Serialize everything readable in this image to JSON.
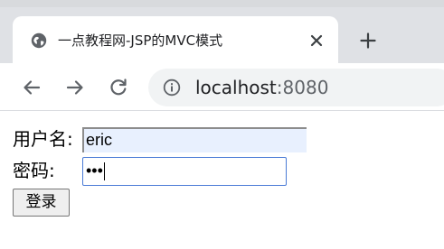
{
  "browser": {
    "tab": {
      "title": "一点教程网-JSP的MVC模式",
      "favicon": "globe-icon",
      "close_icon": "close-icon"
    },
    "new_tab_icon": "plus-icon",
    "toolbar": {
      "back_icon": "back-arrow-icon",
      "forward_icon": "forward-arrow-icon",
      "reload_icon": "reload-icon",
      "info_icon": "info-icon"
    },
    "address": {
      "host": "localhost",
      "port": ":8080"
    },
    "colors": {
      "tab_strip": "#dfe1e5",
      "omnibox": "#f1f3f4",
      "icon": "#5f6368"
    }
  },
  "form": {
    "username_label": "用户名:",
    "username_value": "eric",
    "password_label": "密码:",
    "password_value": "•••",
    "submit_label": "登录",
    "colors": {
      "autofill_bg": "#e8f0fe",
      "focus_border": "#4a7bd6"
    }
  }
}
